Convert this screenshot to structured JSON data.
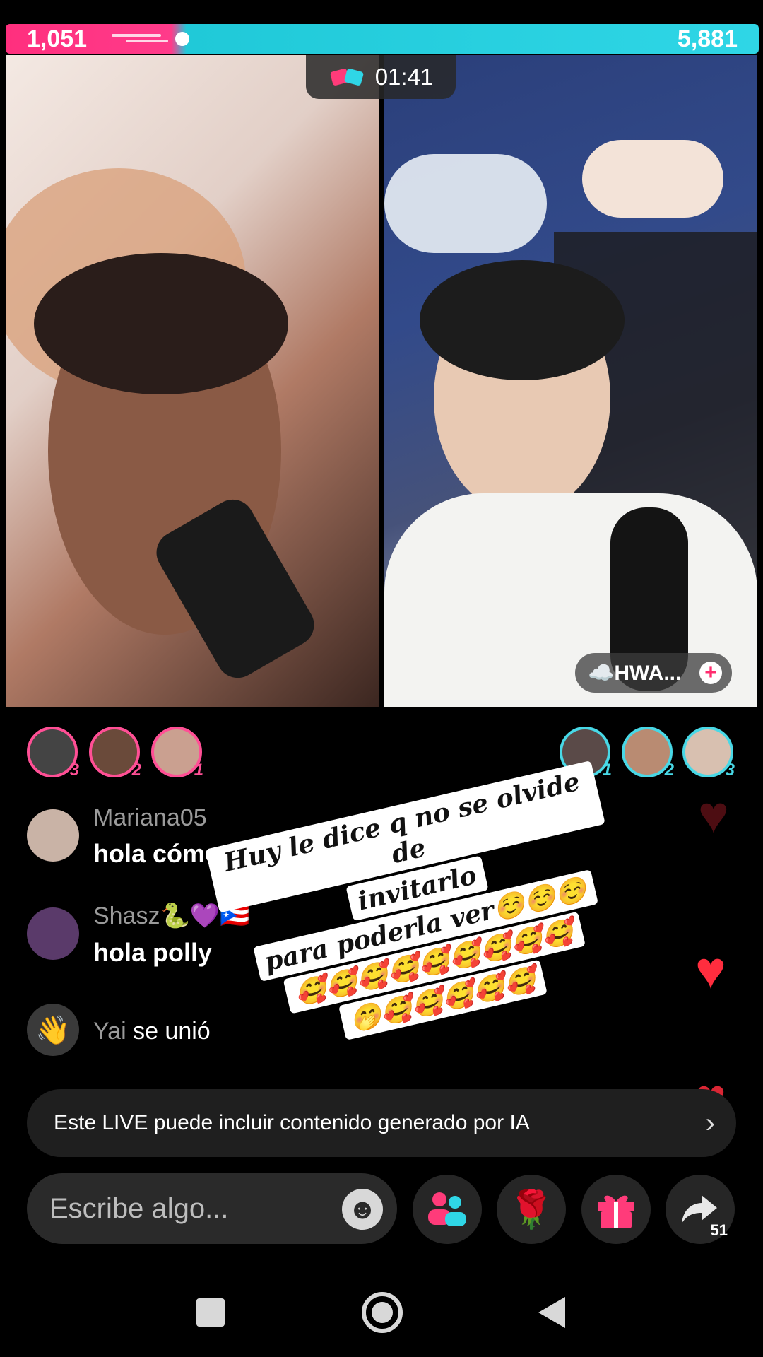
{
  "battle": {
    "left_score": "1,051",
    "right_score": "5,881",
    "timer": "01:41"
  },
  "host_tag": {
    "name": "☁️HWA...",
    "follow_symbol": "+"
  },
  "supporters": {
    "left": [
      {
        "rank": "3"
      },
      {
        "rank": "2"
      },
      {
        "rank": "1"
      }
    ],
    "right": [
      {
        "rank": "1"
      },
      {
        "rank": "2"
      },
      {
        "rank": "3"
      }
    ]
  },
  "chat": {
    "messages": [
      {
        "user": "Mariana05",
        "text": "hola cómo estás"
      },
      {
        "user": "Shasz🐍💜🇵🇷",
        "text": "hola polly"
      }
    ],
    "join": {
      "user": "Yai",
      "text": "se unió"
    }
  },
  "caption": {
    "lines": [
      "Huy le dice q no se olvide de",
      "invitarlo",
      "para poderla ver☺️☺️☺️",
      "🥰🥰🥰🥰🥰🥰🥰🥰🥰",
      "🤭🥰🥰🥰🥰🥰"
    ]
  },
  "ai_banner": {
    "text": "Este LIVE puede incluir contenido generado por IA",
    "chevron": "›"
  },
  "bottom_bar": {
    "placeholder": "Escribe algo...",
    "share_count": "51",
    "icons": [
      "emoji-icon",
      "guests-icon",
      "rose-gift-icon",
      "gift-icon",
      "share-icon"
    ]
  },
  "colors": {
    "left_team": "#ff2f7e",
    "right_team": "#2fd6e6",
    "heart": "#ff2d3e"
  }
}
